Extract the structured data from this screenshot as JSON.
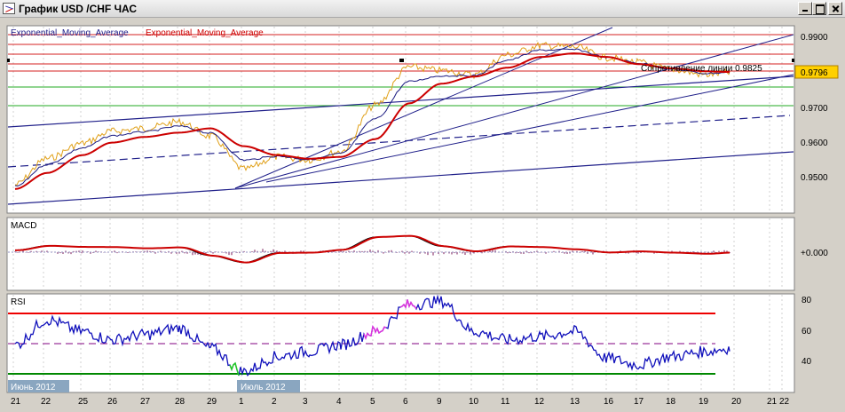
{
  "window": {
    "title": "График USD /CHF  ЧАС"
  },
  "colors": {
    "background": "#ffffff",
    "grid": "#c8c8c8",
    "price": "#e0a018",
    "ema_slow": "#cc0000",
    "ema_fast": "#1a1a80",
    "resistance": "#d62020",
    "support": "#22aa22",
    "trend": "#20208a",
    "macd_hist": "#7a1a5a",
    "rsi_line": "#1010bb",
    "rsi_overbought": "#dd33dd",
    "rsi_oversold": "#22cc22",
    "rsi_upper": "#ee0000",
    "rsi_lower": "#008800",
    "rsi_mid": "#800080"
  },
  "main_panel": {
    "legend": {
      "item1": "Exponential_Moving_Average",
      "item2": "Exponential_Moving_Average"
    },
    "last_price": "0.9796",
    "annotation": "Сопротивление линии 0.9825",
    "y_ticks": [
      "0.9900",
      "0.9800",
      "0.9700",
      "0.9600",
      "0.9500"
    ],
    "y_range": [
      0.9405,
      0.9925
    ]
  },
  "macd_panel": {
    "label": "MACD",
    "zero_label": "+0.000"
  },
  "rsi_panel": {
    "label": "RSI",
    "y_ticks": [
      "80",
      "60",
      "40"
    ],
    "upper_level": 70,
    "lower_level": 30,
    "mid_level": 50
  },
  "time_axis": {
    "labels": [
      "21",
      "22",
      "25",
      "26",
      "27",
      "28",
      "29",
      "1",
      "2",
      "3",
      "4",
      "5",
      "6",
      "9",
      "10",
      "11",
      "12",
      "13",
      "16",
      "17",
      "18",
      "19",
      "20",
      "21",
      "22"
    ],
    "month_labels": [
      "Июнь 2012",
      "Июль 2012"
    ]
  },
  "chart_data": {
    "type": "line",
    "title": "График USD /CHF  ЧАС",
    "x": [
      "21",
      "22",
      "25",
      "26",
      "27",
      "28",
      "29",
      "1",
      "2",
      "3",
      "4",
      "5",
      "6",
      "9",
      "10",
      "11",
      "12",
      "13",
      "16",
      "17",
      "18",
      "19",
      "20"
    ],
    "series": [
      {
        "name": "USD/CHF",
        "values": [
          0.9482,
          0.9555,
          0.9598,
          0.9632,
          0.964,
          0.9658,
          0.9618,
          0.9525,
          0.956,
          0.9552,
          0.9575,
          0.9705,
          0.9812,
          0.9802,
          0.979,
          0.9846,
          0.9872,
          0.9868,
          0.9838,
          0.9825,
          0.9805,
          0.979,
          0.9796
        ]
      },
      {
        "name": "Exponential_Moving_Average",
        "values": [
          0.947,
          0.9515,
          0.9565,
          0.96,
          0.9616,
          0.9628,
          0.964,
          0.959,
          0.9565,
          0.9555,
          0.956,
          0.961,
          0.971,
          0.9765,
          0.9785,
          0.981,
          0.984,
          0.985,
          0.984,
          0.982,
          0.9808,
          0.98,
          0.9798
        ]
      }
    ],
    "ylim": [
      0.9405,
      0.9925
    ],
    "rsi": {
      "values": [
        52,
        67,
        60,
        55,
        58,
        62,
        50,
        36,
        45,
        48,
        52,
        60,
        76,
        78,
        60,
        55,
        57,
        60,
        44,
        40,
        45,
        48,
        50
      ],
      "ylim": [
        24,
        82
      ],
      "levels": [
        70,
        50,
        30
      ]
    },
    "grid": true
  }
}
